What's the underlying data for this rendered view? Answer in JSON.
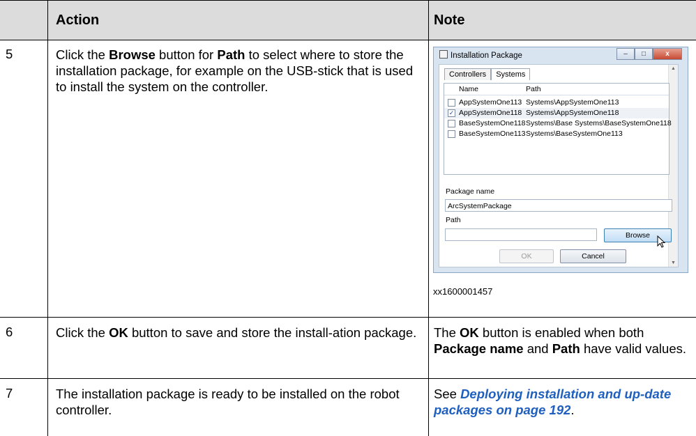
{
  "header": {
    "action": "Action",
    "note": "Note"
  },
  "rows": [
    {
      "number": "5",
      "action_parts": [
        "Click the ",
        "Browse",
        " button for ",
        "Path",
        " to select where to store the installation package, for example on the USB-stick that is used to install the system on the controller."
      ]
    },
    {
      "number": "6",
      "action_parts": [
        "Click the ",
        "OK",
        " button to save and store the install-ation package."
      ],
      "note_parts": [
        "The ",
        "OK",
        " button is enabled when both ",
        "Package name",
        " and ",
        "Path",
        " have valid values."
      ]
    },
    {
      "number": "7",
      "action": "The installation package is ready to be installed on the robot controller.",
      "note_prefix": "See ",
      "note_link": "Deploying installation and up-date packages on page 192",
      "note_suffix": "."
    }
  ],
  "dialog": {
    "title": "Installation Package",
    "window_buttons": [
      "–",
      "□",
      "x"
    ],
    "tabs": [
      "Controllers",
      "Systems"
    ],
    "active_tab": "Systems",
    "list_headers": {
      "name": "Name",
      "path": "Path"
    },
    "list_rows": [
      {
        "name": "AppSystemOne113",
        "path": "Systems\\AppSystemOne113",
        "checked": false
      },
      {
        "name": "AppSystemOne118",
        "path": "Systems\\AppSystemOne118",
        "checked": true
      },
      {
        "name": "BaseSystemOne118",
        "path": "Systems\\Base Systems\\BaseSystemOne118",
        "checked": false
      },
      {
        "name": "BaseSystemOne113",
        "path": "Systems\\BaseSystemOne113",
        "checked": false
      }
    ],
    "check_mark": "✓",
    "package_name_label": "Package name",
    "package_name_value": "ArcSystemPackage",
    "path_label": "Path",
    "path_value": "",
    "browse_label": "Browse",
    "ok_label": "OK",
    "cancel_label": "Cancel",
    "scroll_up": "▲",
    "scroll_down": "▼"
  },
  "figure_id": "xx1600001457"
}
